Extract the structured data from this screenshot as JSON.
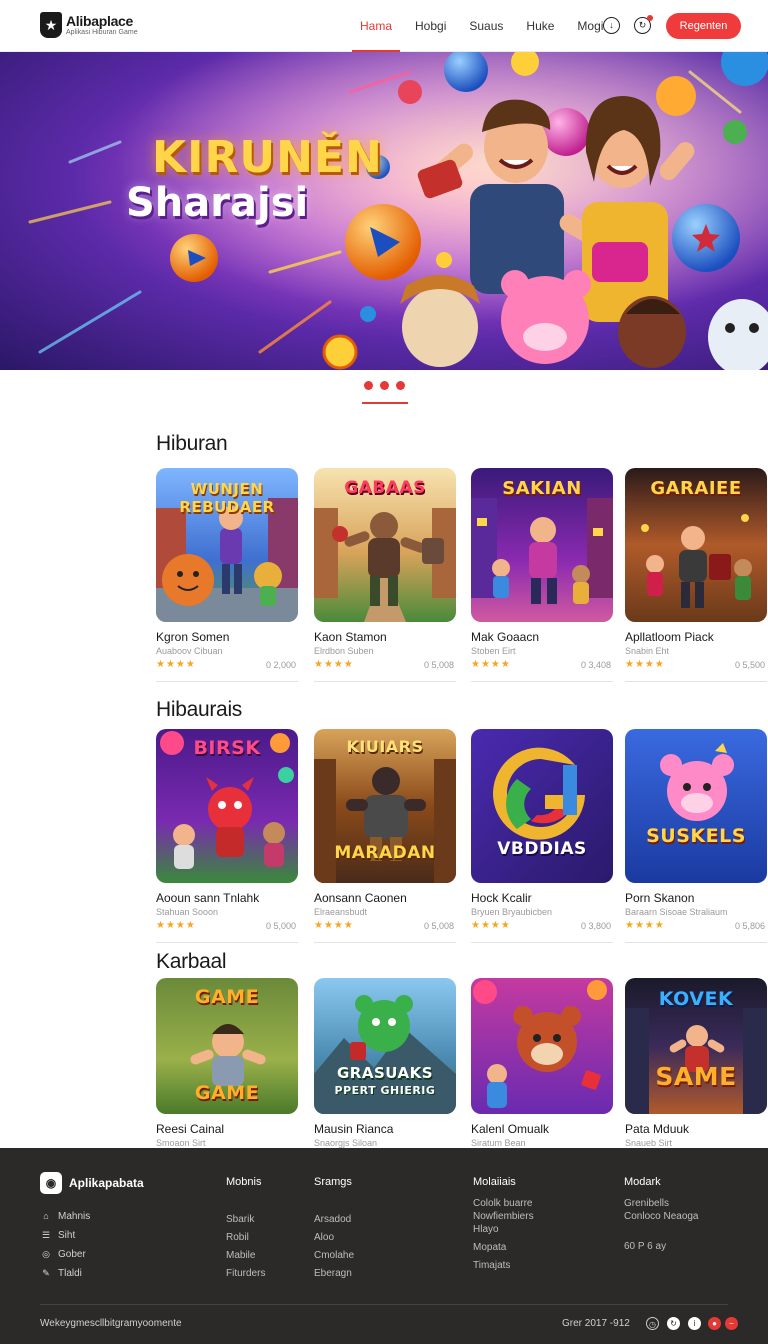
{
  "header": {
    "logo_name": "Alibaplace",
    "logo_tagline": "Aplikasi Hiburan Game",
    "nav": [
      {
        "label": "Hama",
        "active": true
      },
      {
        "label": "Hobgi",
        "active": false
      },
      {
        "label": "Suaus",
        "active": false
      },
      {
        "label": "Huke",
        "active": false
      },
      {
        "label": "Mogi",
        "active": false
      }
    ],
    "register_label": "Regenten",
    "icons": [
      "download-icon",
      "notification-icon"
    ]
  },
  "hero": {
    "title_line1": "KIRUNĚN",
    "title_line2": "Sharajsi",
    "slides": 3,
    "active_slide": 1
  },
  "sections": [
    {
      "title": "Hiburan",
      "cards": [
        {
          "name": "Kgron Somen",
          "sub": "Auaboov Cibuan",
          "stars": "★★★★",
          "count": "0 2,000",
          "art": "WUNJEN REBUDAER"
        },
        {
          "name": "Kaon Stamon",
          "sub": "Elrdbon Suben",
          "stars": "★★★★",
          "count": "0 5,008",
          "art": "GABAAS"
        },
        {
          "name": "Mak Goaacn",
          "sub": "Stoben Eirt",
          "stars": "★★★★",
          "count": "0 3,408",
          "art": "SAKIAN"
        },
        {
          "name": "Apllatloom Piack",
          "sub": "Snabin Eht",
          "stars": "★★★★",
          "count": "0 5,500",
          "art": "GARAIEE"
        }
      ]
    },
    {
      "title": "Hibaurais",
      "cards": [
        {
          "name": "Aooun sann Tnlahk",
          "sub": "Stahuan Sooon",
          "stars": "★★★★",
          "count": "0 5,000",
          "art": "BIRSK"
        },
        {
          "name": "Aonsann Caonen",
          "sub": "Elraeansbudt",
          "stars": "★★★★",
          "count": "0 5,008",
          "art": "KIUIARS"
        },
        {
          "name": "Hock Kcalir",
          "sub": "Bryuen Bryaubicben",
          "stars": "★★★★",
          "count": "0 3,800",
          "art": "VBDDIAS"
        },
        {
          "name": "Porn Skanon",
          "sub": "Baraarn Sisoae Straliaum",
          "stars": "★★★★",
          "count": "0 5,806",
          "art": "SUSKELS"
        }
      ]
    },
    {
      "title": "Karbaal",
      "cards": [
        {
          "name": "Reesi Cainal",
          "sub": "Smoaon Sirt",
          "art": "GAME"
        },
        {
          "name": "Mausin Rianca",
          "sub": "Snaorgjs Siloan",
          "art": "GRASUAKS"
        },
        {
          "name": "Kalenl Omualk",
          "sub": "Siratum Bean",
          "art": ""
        },
        {
          "name": "Pata Mduuk",
          "sub": "Snaueb Sirt",
          "art": "KOVEK SAME"
        }
      ]
    }
  ],
  "footer": {
    "brand": "Aplikapabata",
    "left_items": [
      {
        "icon": "home-icon",
        "label": "Mahnis"
      },
      {
        "icon": "list-icon",
        "label": "Siht"
      },
      {
        "icon": "target-icon",
        "label": "Gober"
      },
      {
        "icon": "chat-icon",
        "label": "Tlaldi"
      }
    ],
    "columns": [
      {
        "head": "Mobnis",
        "items": [
          "Sbarik",
          "Robil",
          "Mabile",
          "Fiturders"
        ]
      },
      {
        "head": "Sramgs",
        "items": [
          "Arsadod",
          "Aloo",
          "Cmolahe",
          "Eberagn"
        ]
      },
      {
        "head": "Molaiiais",
        "items": [
          "Cololk buarre",
          "Nowfiembiers",
          "Hlayo",
          "Mopata",
          "Timajats"
        ]
      },
      {
        "head": "Modark",
        "items": [
          "Grenibells",
          "Conloco Neaoga",
          "",
          "60 P 6 ay"
        ]
      }
    ],
    "bottom_left": "Wekeygmescllbitgramyoomente",
    "bottom_right": "Grer 2017 -912",
    "social": [
      "clock-icon",
      "refresh-icon",
      "info-icon",
      "record-icon",
      "minus-icon"
    ]
  }
}
